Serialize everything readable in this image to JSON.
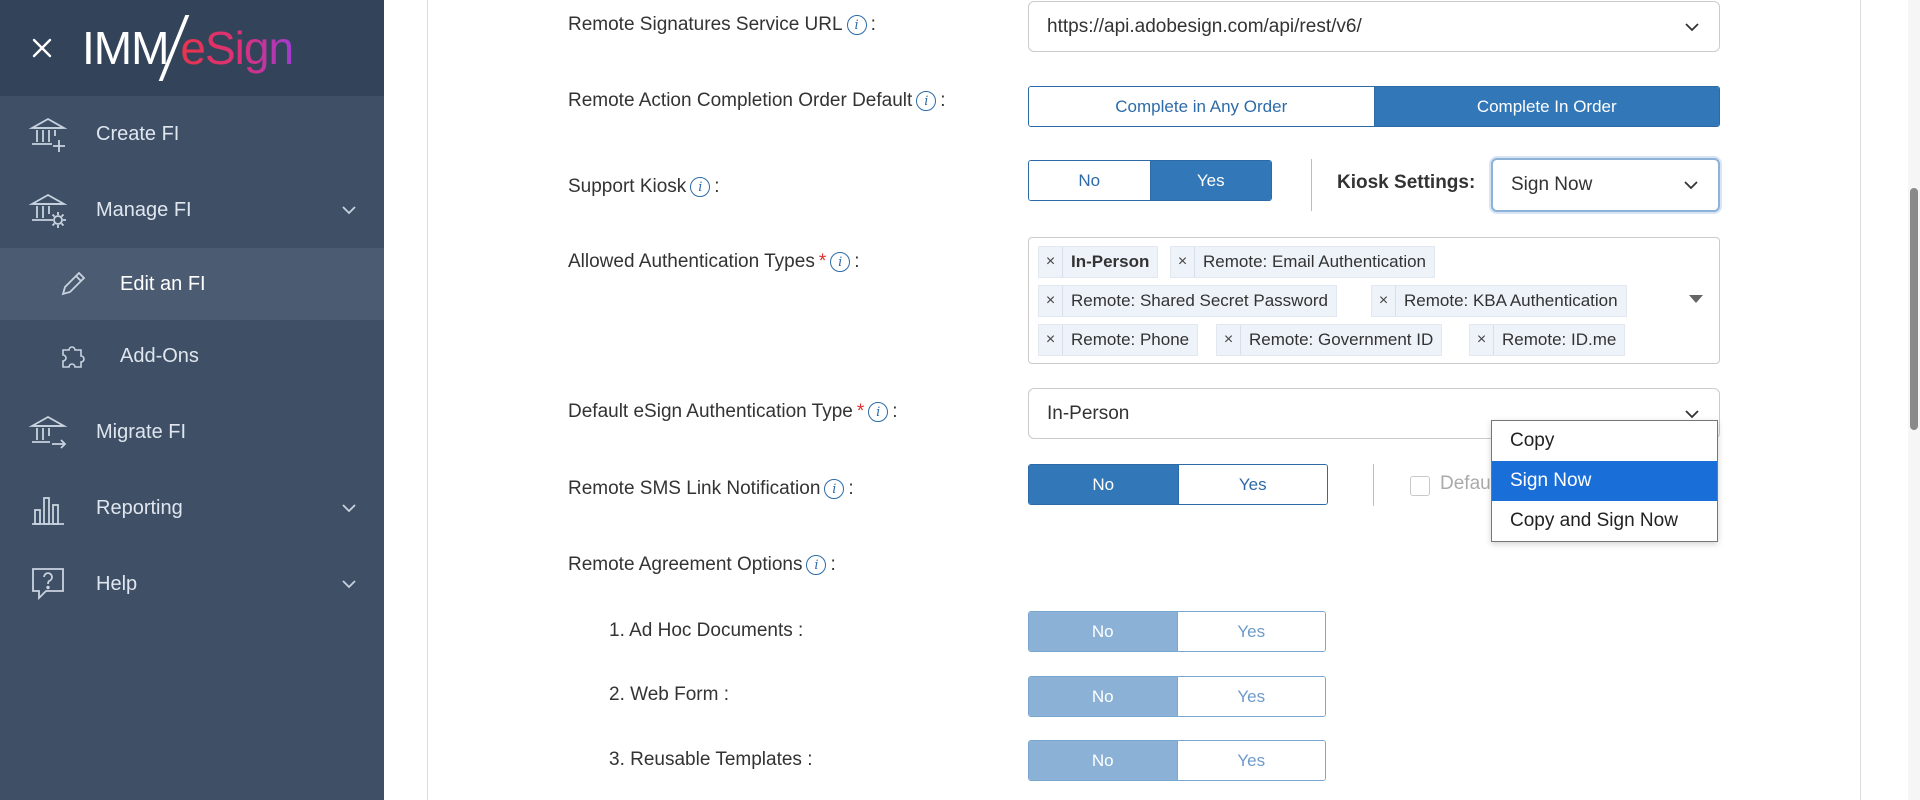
{
  "app": {
    "logo_text_primary": "IMM",
    "logo_text_brand": "eSign"
  },
  "sidebar": {
    "items": [
      {
        "label": "Create FI",
        "icon": "bank-plus-icon"
      },
      {
        "label": "Manage FI",
        "icon": "bank-gear-icon",
        "expandable": true
      },
      {
        "label": "Edit an FI",
        "icon": "pencil-icon",
        "sub": true,
        "active": true
      },
      {
        "label": "Add-Ons",
        "icon": "puzzle-icon",
        "sub": true
      },
      {
        "label": "Migrate FI",
        "icon": "bank-arrow-icon"
      },
      {
        "label": "Reporting",
        "icon": "bar-chart-icon",
        "expandable": true
      },
      {
        "label": "Help",
        "icon": "help-bubble-icon",
        "expandable": true
      }
    ]
  },
  "form": {
    "remote_url": {
      "label": "Remote Signatures Service URL",
      "suffix": ":",
      "value": "https://api.adobesign.com/api/rest/v6/"
    },
    "completion_order": {
      "label": "Remote Action Completion Order Default",
      "suffix": ":",
      "options": [
        "Complete in Any Order",
        "Complete In Order"
      ],
      "selected": "Complete In Order"
    },
    "support_kiosk": {
      "label": "Support Kiosk",
      "suffix": ":",
      "options": [
        "No",
        "Yes"
      ],
      "selected": "Yes",
      "kiosk_settings_label": "Kiosk Settings:",
      "kiosk_settings_value": "Sign Now"
    },
    "auth_types": {
      "label": "Allowed Authentication Types",
      "required_mark": "*",
      "suffix": ":",
      "tags": [
        {
          "text": "In-Person",
          "bold": true
        },
        {
          "text": "Remote: Email Authentication"
        },
        {
          "text": "Remote: Shared Secret Password"
        },
        {
          "text": "Remote: KBA Authentication"
        },
        {
          "text": "Remote: Phone"
        },
        {
          "text": "Remote: Government ID"
        },
        {
          "text": "Remote: ID.me"
        }
      ],
      "remove_glyph": "×"
    },
    "default_auth": {
      "label": "Default eSign Authentication Type",
      "required_mark": "*",
      "suffix": ":",
      "value": "In-Person"
    },
    "sms_link": {
      "label": "Remote SMS Link Notification",
      "suffix": ":",
      "options": [
        "No",
        "Yes"
      ],
      "selected": "No",
      "checkbox_label": "Defau"
    },
    "agreement_options": {
      "label": "Remote Agreement Options",
      "suffix": ":",
      "items": [
        {
          "label": "1. Ad Hoc Documents :",
          "options": [
            "No",
            "Yes"
          ],
          "selected": "No"
        },
        {
          "label": "2. Web Form :",
          "options": [
            "No",
            "Yes"
          ],
          "selected": "No"
        },
        {
          "label": "3. Reusable Templates :",
          "options": [
            "No",
            "Yes"
          ],
          "selected": "No"
        }
      ]
    }
  },
  "kiosk_dropdown": {
    "options": [
      "Copy",
      "Sign Now",
      "Copy and Sign Now"
    ],
    "highlighted": "Sign Now"
  },
  "colors": {
    "sidebar_bg": "#3e4f66",
    "accent": "#3277b8",
    "highlight": "#1a6ed8",
    "required": "#d9302a"
  }
}
